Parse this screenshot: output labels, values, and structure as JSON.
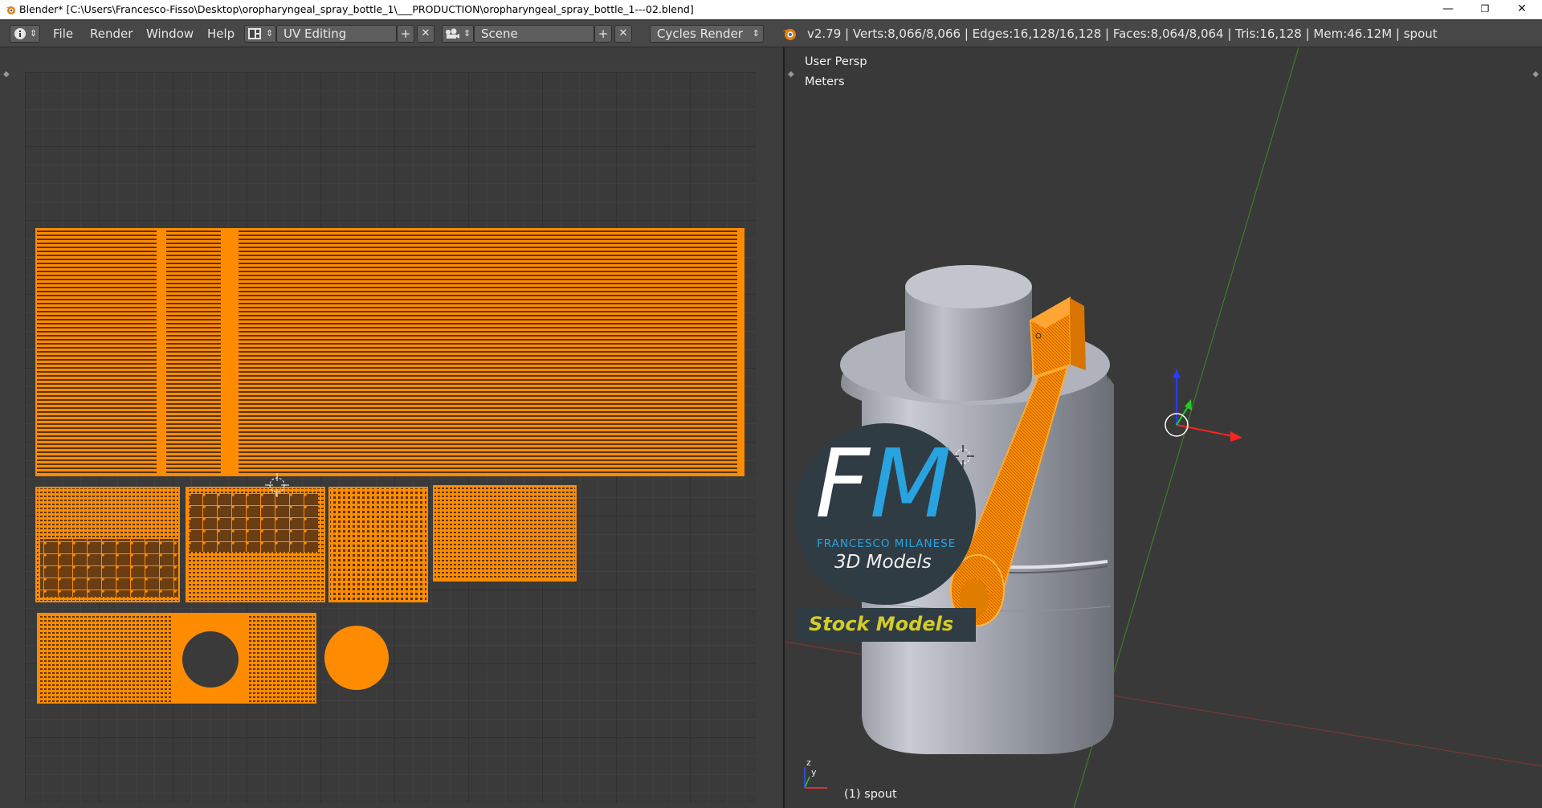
{
  "window": {
    "title": "Blender* [C:\\Users\\Francesco-Fisso\\Desktop\\oropharyngeal_spray_bottle_1\\___PRODUCTION\\oropharyngeal_spray_bottle_1---02.blend]",
    "minimize": "—",
    "maximize": "❐",
    "close": "✕"
  },
  "header": {
    "menus": [
      "File",
      "Render",
      "Window",
      "Help"
    ],
    "screen_layout": "UV Editing",
    "scene": "Scene",
    "render_engine": "Cycles Render",
    "stats": "v2.79 | Verts:8,066/8,066 | Edges:16,128/16,128 | Faces:8,064/8,064 | Tris:16,128 | Mem:46.12M | spout",
    "add_glyph": "+",
    "remove_glyph": "✕",
    "dropdown_glyph": "⇕"
  },
  "viewport": {
    "view_name": "User Persp",
    "units": "Meters",
    "selected_object": "(1) spout",
    "axis_y": "y",
    "axis_z": "z"
  },
  "logo": {
    "monogram_f": "F",
    "monogram_m": "M",
    "name": "FRANCESCO MILANESE",
    "tagline": "3D Models",
    "banner": "Stock Models"
  },
  "icons": {
    "blender": "blender-logo-icon",
    "info": "info-editor-icon",
    "layout": "screen-layout-icon",
    "scene": "scene-icon",
    "cursor": "3d-cursor-icon"
  },
  "colors": {
    "accent_orange": "#ff8c00",
    "bg_dark": "#393939",
    "header": "#474747",
    "logo_blue": "#29a3e0",
    "logo_yellow": "#d4cc2a"
  }
}
